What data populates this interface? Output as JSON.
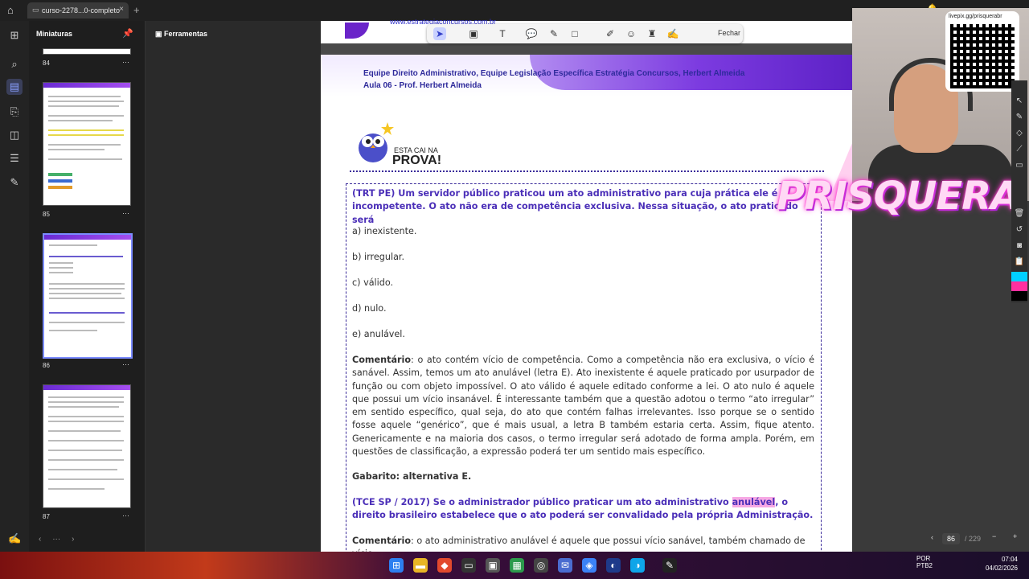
{
  "tabbar": {
    "tab_title": "curso-2278...0-completo"
  },
  "sidebar": {
    "panel_title": "Miniaturas"
  },
  "thumbnails": [
    {
      "page": "84"
    },
    {
      "page": "85"
    },
    {
      "page": "86"
    },
    {
      "page": "87"
    }
  ],
  "tools": {
    "panel_title": "Ferramentas"
  },
  "toolbar": {
    "close_label": "Fechar"
  },
  "document": {
    "url_fragment": "www.estrategiaconcursos.com.br",
    "header_line1": "Equipe Direito Administrativo, Equipe Legislação Específica Estratégia Concursos, Herbert Almeida",
    "header_line2": "Aula 06 - Prof. Herbert Almeida",
    "banner_small": "ESTA CAI NA",
    "banner_big": "PROVA!",
    "q1_stem": "(TRT PE) Um servidor público praticou um ato administrativo para cuja prática ele é incompetente. O ato não era de competência exclusiva. Nessa situação, o ato praticado será",
    "q1_a": "a) inexistente.",
    "q1_b": "b) irregular.",
    "q1_c": "c) válido.",
    "q1_d": "d) nulo.",
    "q1_e": "e) anulável.",
    "comment_label": "Comentário",
    "q1_comment": ": o ato contém vício de competência. Como a competência não era exclusiva, o vício é sanável. Assim, temos um ato anulável (letra E). Ato inexistente é aquele praticado por usurpador de função ou com objeto impossível. O ato válido é aquele editado conforme a lei. O ato nulo é aquele que possui um vício insanável. É interessante também que a questão adotou o termo “ato irregular” em sentido específico, qual seja, do ato que contém falhas irrelevantes. Isso porque se o sentido fosse aquele “genérico”, que é mais usual, a letra B também estaria certa. Assim, fique atento. Genericamente e na maioria dos casos, o termo irregular será adotado de forma ampla. Porém, em questões de classificação, a expressão poderá ter um sentido mais específico.",
    "q1_answer": "Gabarito: alternativa E.",
    "q2_stem_a": "(TCE SP / 2017) Se o administrador público praticar um ato administrativo ",
    "q2_highlight": "anulável",
    "q2_stem_b": ", o direito brasileiro estabelece que o ato poderá ser convalidado pela própria Administração.",
    "q2_comment": ": o ato administrativo anulável é aquele que possui vício sanável, também chamado de vício"
  },
  "status": {
    "page_current": "86",
    "page_total": "/ 229"
  },
  "overlay": {
    "qr_caption": "livepix.gg/prisquerabr",
    "streamer_name": "PRISQUERA"
  },
  "system": {
    "lang": "POR",
    "layout": "PTB2",
    "time": "07:04",
    "date": "04/02/2026"
  }
}
